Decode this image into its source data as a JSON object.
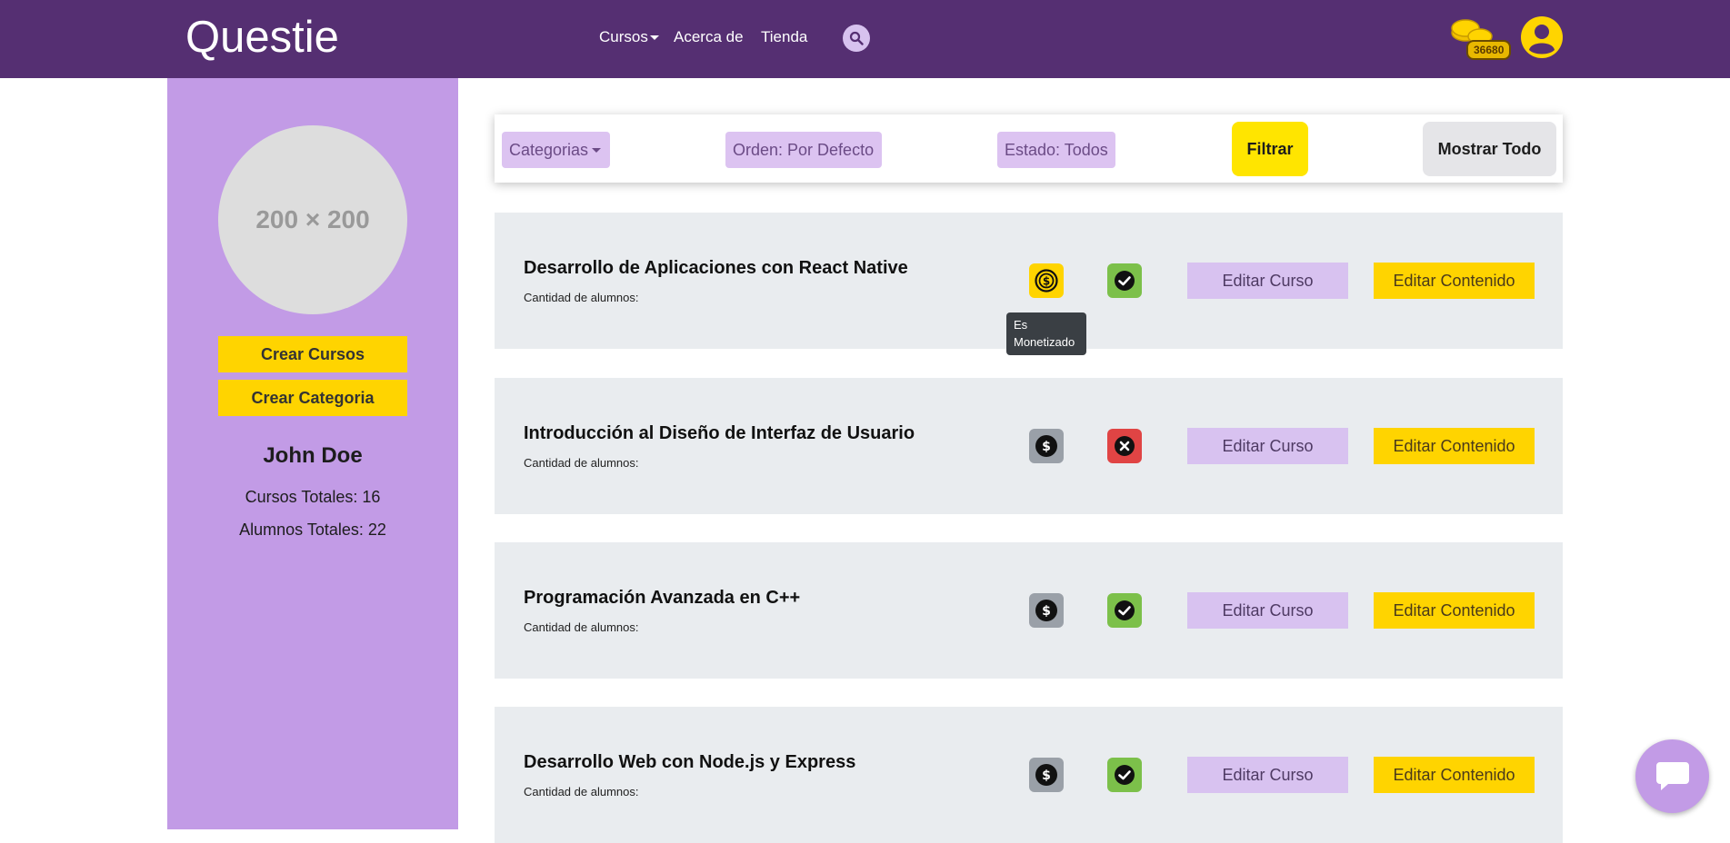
{
  "brand": {
    "title": "Questie"
  },
  "nav": {
    "cursos": "Cursos",
    "acerca": "Acerca de",
    "tienda": "Tienda",
    "search_icon": "search-icon"
  },
  "wallet": {
    "coins": "36680"
  },
  "sidebar": {
    "avatar_placeholder": "200 × 200",
    "crear_cursos": "Crear Cursos",
    "crear_categoria": "Crear Categoria",
    "user_name": "John Doe",
    "cursos_totales": "Cursos Totales: 16",
    "alumnos_totales": "Alumnos Totales: 22"
  },
  "filters": {
    "categorias": "Categorias",
    "orden": "Orden: Por Defecto",
    "estado": "Estado: Todos",
    "filtrar": "Filtrar",
    "mostrar_todo": "Mostrar Todo"
  },
  "courses": [
    {
      "title": "Desarrollo de Aplicaciones con React Native",
      "subtitle": "Cantidad de alumnos:",
      "monetized": true,
      "active": true,
      "edit_curso": "Editar Curso",
      "edit_contenido": "Editar Contenido"
    },
    {
      "title": "Introducción al Diseño de Interfaz de Usuario",
      "subtitle": "Cantidad de alumnos:",
      "monetized": false,
      "active": false,
      "edit_curso": "Editar Curso",
      "edit_contenido": "Editar Contenido"
    },
    {
      "title": "Programación Avanzada en C++",
      "subtitle": "Cantidad de alumnos:",
      "monetized": false,
      "active": true,
      "edit_curso": "Editar Curso",
      "edit_contenido": "Editar Contenido"
    },
    {
      "title": "Desarrollo Web con Node.js y Express",
      "subtitle": "Cantidad de alumnos:",
      "monetized": false,
      "active": true,
      "edit_curso": "Editar Curso",
      "edit_contenido": "Editar Contenido"
    }
  ],
  "tooltip": {
    "text_line1": "Es",
    "text_line2": "Monetizado"
  },
  "colors": {
    "navbar": "#552f72",
    "sidebar": "#c29be6",
    "accent_yellow": "#ffd400",
    "monetized_on": "#ffd400",
    "monetized_off": "#9aa0a8",
    "status_ok": "#7cc04a",
    "status_bad": "#e04444"
  }
}
